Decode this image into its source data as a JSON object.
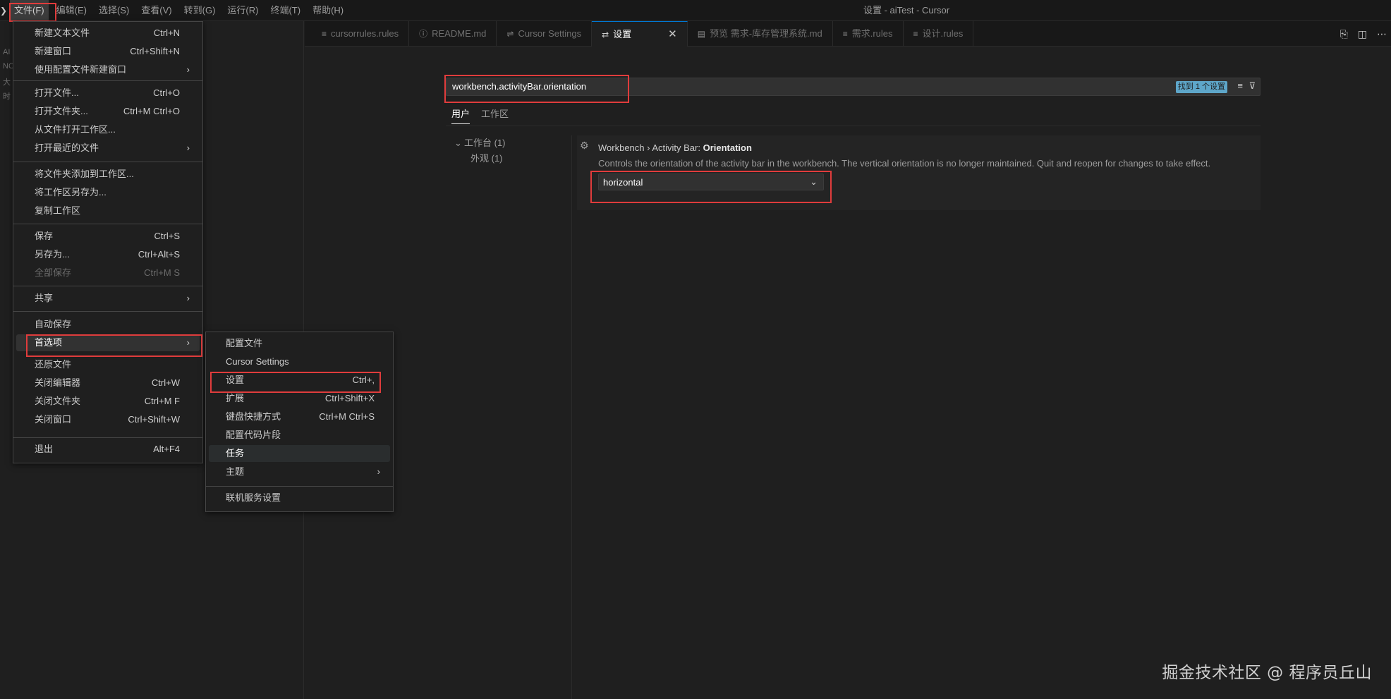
{
  "window_title": "设置 - aiTest - Cursor",
  "menubar": [
    "文件(F)",
    "编辑(E)",
    "选择(S)",
    "查看(V)",
    "转到(G)",
    "运行(R)",
    "终端(T)",
    "帮助(H)"
  ],
  "activity_strip": [
    "AI",
    "NC",
    "大",
    "时"
  ],
  "tabs": [
    {
      "label": "cursorrules.rules",
      "icon": "file-lines-icon"
    },
    {
      "label": "README.md",
      "icon": "info-icon"
    },
    {
      "label": "Cursor Settings",
      "icon": "sliders-icon"
    },
    {
      "label": "设置",
      "icon": "settings-sliders-icon",
      "active": true
    },
    {
      "label": "预览 需求-库存管理系统.md",
      "icon": "preview-icon"
    },
    {
      "label": "需求.rules",
      "icon": "file-lines-icon"
    },
    {
      "label": "设计.rules",
      "icon": "file-lines-icon"
    }
  ],
  "settings": {
    "search_value": "workbench.activityBar.orientation",
    "search_count": "找到 1 个设置",
    "scope_tabs": [
      "用户",
      "工作区"
    ],
    "toc": [
      {
        "label": "工作台 (1)"
      },
      {
        "label": "外观 (1)"
      }
    ],
    "item": {
      "title_prefix": "Workbench › Activity Bar: ",
      "title_name": "Orientation",
      "description": "Controls the orientation of the activity bar in the workbench. The vertical orientation is no longer maintained. Quit and reopen for changes to take effect.",
      "value": "horizontal"
    }
  },
  "file_menu": {
    "items": [
      {
        "label": "新建文本文件",
        "shortcut": "Ctrl+N"
      },
      {
        "label": "新建窗口",
        "shortcut": "Ctrl+Shift+N"
      },
      {
        "label": "使用配置文件新建窗口",
        "submenu": true
      },
      {
        "label": "打开文件...",
        "shortcut": "Ctrl+O"
      },
      {
        "label": "打开文件夹...",
        "shortcut": "Ctrl+M Ctrl+O"
      },
      {
        "label": "从文件打开工作区..."
      },
      {
        "label": "打开最近的文件",
        "submenu": true
      },
      {
        "label": "将文件夹添加到工作区..."
      },
      {
        "label": "将工作区另存为..."
      },
      {
        "label": "复制工作区"
      },
      {
        "label": "保存",
        "shortcut": "Ctrl+S"
      },
      {
        "label": "另存为...",
        "shortcut": "Ctrl+Alt+S"
      },
      {
        "label": "全部保存",
        "shortcut": "Ctrl+M S",
        "disabled": true
      },
      {
        "label": "共享",
        "submenu": true
      },
      {
        "label": "自动保存"
      },
      {
        "label": "首选项",
        "submenu": true,
        "selected": true
      },
      {
        "label": "还原文件"
      },
      {
        "label": "关闭编辑器",
        "shortcut": "Ctrl+W"
      },
      {
        "label": "关闭文件夹",
        "shortcut": "Ctrl+M F"
      },
      {
        "label": "关闭窗口",
        "shortcut": "Ctrl+Shift+W"
      },
      {
        "label": "退出",
        "shortcut": "Alt+F4"
      }
    ]
  },
  "preferences_menu": {
    "items": [
      {
        "label": "配置文件"
      },
      {
        "label": "Cursor Settings"
      },
      {
        "label": "设置",
        "shortcut": "Ctrl+,"
      },
      {
        "label": "扩展",
        "shortcut": "Ctrl+Shift+X"
      },
      {
        "label": "键盘快捷方式",
        "shortcut": "Ctrl+M Ctrl+S"
      },
      {
        "label": "配置代码片段"
      },
      {
        "label": "任务",
        "hover": true
      },
      {
        "label": "主题",
        "submenu": true
      },
      {
        "label": "联机服务设置"
      }
    ]
  },
  "watermark": "掘金技术社区 @ 程序员丘山",
  "colors": {
    "accent": "#0078d4",
    "highlight": "#e03c3c",
    "background": "#1f1f1f"
  }
}
